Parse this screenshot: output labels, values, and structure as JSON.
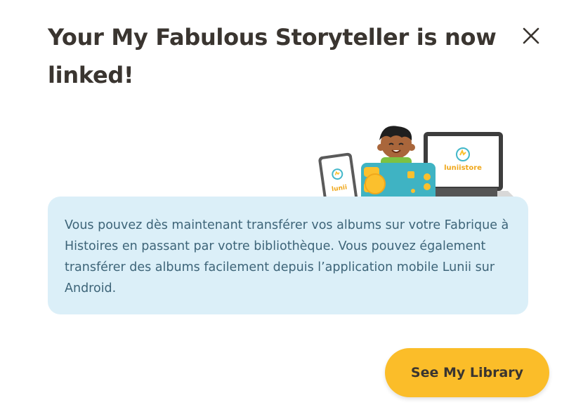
{
  "dialog": {
    "title": "Your My Fabulous Storyteller is now linked!",
    "close_icon": "close-icon",
    "message": "Vous pouvez dès maintenant transférer vos albums sur votre Fabrique à Histoires en passant par votre bibliothèque. Vous pouvez également transférer des albums facilement depuis l’application mobile Lunii sur Android.",
    "primary_button": "See My Library"
  },
  "illustration": {
    "phone_label": "lunii",
    "laptop_label": "luniistore"
  },
  "colors": {
    "title_text": "#3a3530",
    "info_background": "#dbeff8",
    "info_text": "#3d6478",
    "button_background": "#fbbd29",
    "device_teal": "#3fb3c3",
    "device_yellow": "#fbc02d"
  }
}
